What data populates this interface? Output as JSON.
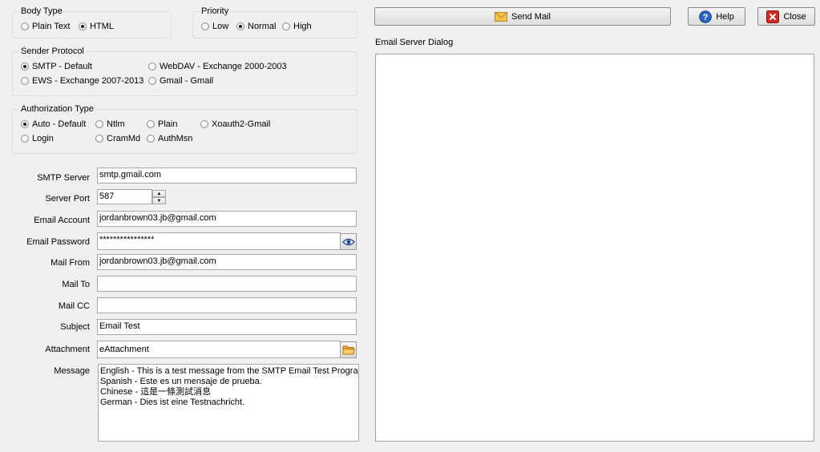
{
  "body_type": {
    "legend": "Body Type",
    "options": [
      {
        "label": "Plain Text",
        "selected": false
      },
      {
        "label": "HTML",
        "selected": true
      }
    ]
  },
  "priority": {
    "legend": "Priority",
    "options": [
      {
        "label": "Low",
        "selected": false
      },
      {
        "label": "Normal",
        "selected": true
      },
      {
        "label": "High",
        "selected": false
      }
    ]
  },
  "sender_protocol": {
    "legend": "Sender Protocol",
    "options": [
      {
        "label": "SMTP - Default",
        "selected": true
      },
      {
        "label": "WebDAV - Exchange 2000-2003",
        "selected": false
      },
      {
        "label": "EWS - Exchange 2007-2013",
        "selected": false
      },
      {
        "label": "Gmail - Gmail",
        "selected": false
      }
    ]
  },
  "authorization": {
    "legend": "Authorization Type",
    "options": [
      {
        "label": "Auto - Default",
        "selected": true
      },
      {
        "label": "Ntlm",
        "selected": false
      },
      {
        "label": "Plain",
        "selected": false
      },
      {
        "label": "Xoauth2-Gmail",
        "selected": false
      },
      {
        "label": "Login",
        "selected": false
      },
      {
        "label": "CramMd",
        "selected": false
      },
      {
        "label": "AuthMsn",
        "selected": false
      }
    ]
  },
  "form": {
    "smtp_server": {
      "label": "SMTP Server",
      "value": "smtp.gmail.com"
    },
    "server_port": {
      "label": "Server Port",
      "value": "587"
    },
    "email_account": {
      "label": "Email Account",
      "value": "jordanbrown03.jb@gmail.com"
    },
    "email_password": {
      "label": "Email Password",
      "value": "****************"
    },
    "mail_from": {
      "label": "Mail From",
      "value": "jordanbrown03.jb@gmail.com"
    },
    "mail_to": {
      "label": "Mail To",
      "value": ""
    },
    "mail_cc": {
      "label": "Mail CC",
      "value": ""
    },
    "subject": {
      "label": "Subject",
      "value": "Email Test"
    },
    "attachment": {
      "label": "Attachment",
      "value": "eAttachment"
    },
    "message": {
      "label": "Message",
      "lines": [
        "English - This is a test message from the SMTP Email Test Program.",
        "Spanish - Este es un mensaje de prueba.",
        "Chinese - 這是一條測試消息",
        "German - Dies ist eine Testnachricht."
      ]
    }
  },
  "toolbar": {
    "send_label": "Send Mail",
    "help_label": "Help",
    "close_label": "Close"
  },
  "dialog": {
    "title": "Email Server Dialog",
    "content": ""
  },
  "icons": {
    "send": "envelope-icon",
    "help": "help-icon",
    "close": "close-icon",
    "password_toggle": "eye-icon",
    "attachment_browse": "folder-icon"
  },
  "colors": {
    "help_blue": "#2b64c4",
    "close_red": "#d12b22",
    "envelope_yellow": "#f2c14e",
    "folder_orange": "#f0a830"
  }
}
